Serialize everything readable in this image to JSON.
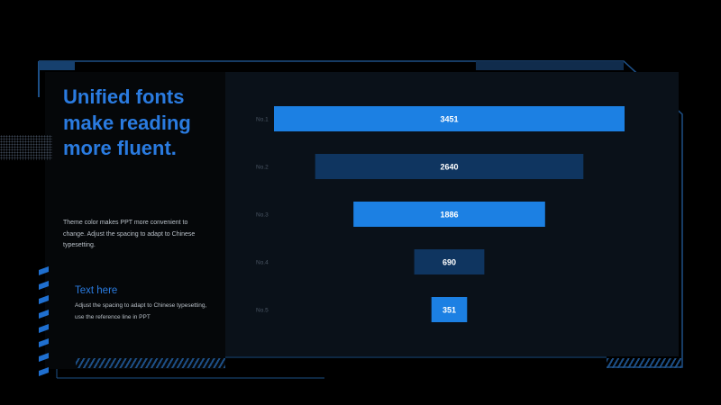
{
  "headline": "Unified fonts make reading more fluent.",
  "body_text": "Theme color makes PPT more convenient to change. Adjust the spacing to adapt to Chinese typesetting.",
  "sub_title": "Text here",
  "sub_text": "Adjust the spacing to adapt to Chinese typesetting, use the reference line in PPT",
  "colors": {
    "accent": "#1c80e3",
    "dark_bar": "#0f3560",
    "background": "#000000",
    "panel": "#0a1119",
    "frame": "#1d4f86"
  },
  "chart_data": {
    "type": "bar",
    "orientation": "funnel",
    "categories": [
      "No.1",
      "No.2",
      "No.3",
      "No.4",
      "No.5"
    ],
    "values": [
      3451,
      2640,
      1886,
      690,
      351
    ],
    "bar_colors": [
      "#1c80e3",
      "#0f3560",
      "#1c80e3",
      "#0f3560",
      "#1c80e3"
    ],
    "xlim": [
      0,
      3451
    ],
    "title": "",
    "xlabel": "",
    "ylabel": ""
  }
}
